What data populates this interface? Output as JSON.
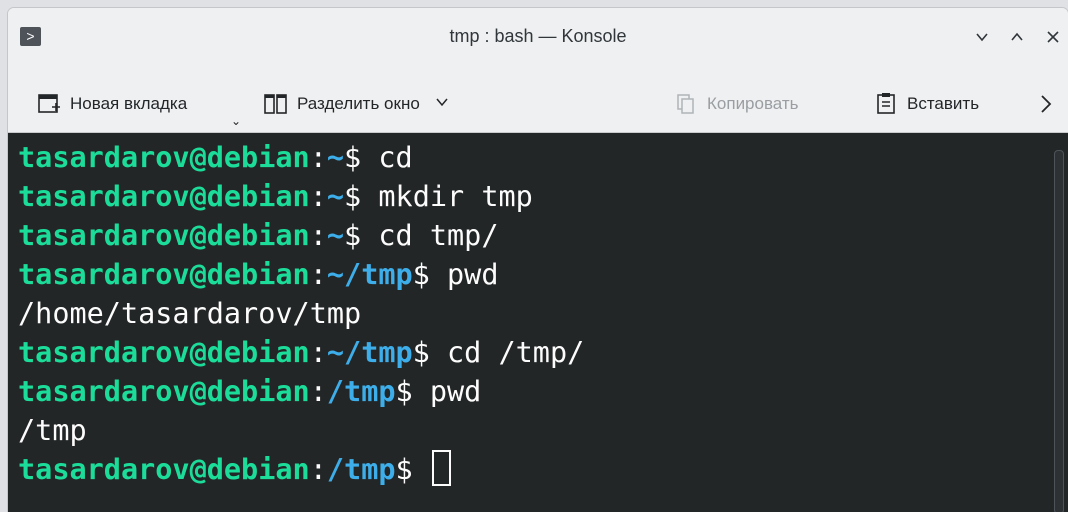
{
  "window": {
    "title": "tmp : bash — Konsole",
    "app_icon": "terminal-prompt-icon"
  },
  "window_controls": [
    "minimize",
    "maximize",
    "close"
  ],
  "toolbar": {
    "new_tab_label": "Новая вкладка",
    "split_view_label": "Разделить окно",
    "copy_label": "Копировать",
    "paste_label": "Вставить"
  },
  "terminal": {
    "colors": {
      "background": "#232627",
      "user_host": "#1cdc9a",
      "path": "#3daee9",
      "text": "#fcfcfc"
    },
    "lines": [
      {
        "user": "tasardarov@debian",
        "sep": ":",
        "path": "~",
        "prompt": "$",
        "cmd": " cd"
      },
      {
        "user": "tasardarov@debian",
        "sep": ":",
        "path": "~",
        "prompt": "$",
        "cmd": " mkdir tmp"
      },
      {
        "user": "tasardarov@debian",
        "sep": ":",
        "path": "~",
        "prompt": "$",
        "cmd": " cd tmp/"
      },
      {
        "user": "tasardarov@debian",
        "sep": ":",
        "path": "~/tmp",
        "prompt": "$",
        "cmd": " pwd"
      },
      {
        "output": "/home/tasardarov/tmp"
      },
      {
        "user": "tasardarov@debian",
        "sep": ":",
        "path": "~/tmp",
        "prompt": "$",
        "cmd": " cd /tmp/"
      },
      {
        "user": "tasardarov@debian",
        "sep": ":",
        "path": "/tmp",
        "prompt": "$",
        "cmd": " pwd"
      },
      {
        "output": "/tmp"
      },
      {
        "user": "tasardarov@debian",
        "sep": ":",
        "path": "/tmp",
        "prompt": "$",
        "cmd": " "
      }
    ]
  }
}
